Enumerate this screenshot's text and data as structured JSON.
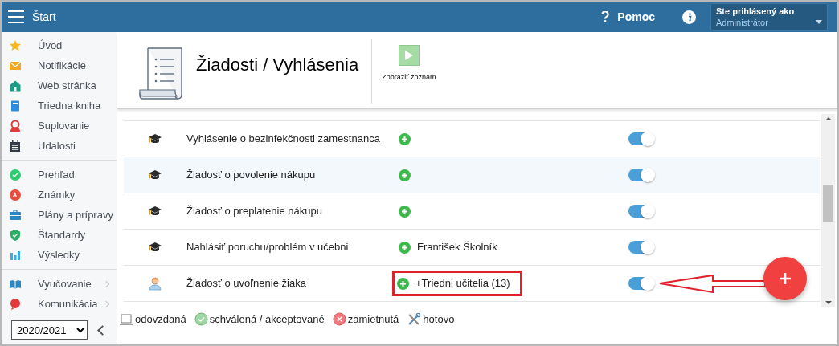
{
  "app_bar": {
    "title": "Štart",
    "help": "Pomoc",
    "user": {
      "label": "Ste prihlásený ako",
      "name": "Administrátor"
    }
  },
  "sidebar": {
    "groups": [
      {
        "items": [
          {
            "label": "Úvod",
            "submenu": false
          },
          {
            "label": "Notifikácie",
            "submenu": false
          },
          {
            "label": "Web stránka",
            "submenu": false
          },
          {
            "label": "Triedna kniha",
            "submenu": false
          },
          {
            "label": "Suplovanie",
            "submenu": false
          },
          {
            "label": "Udalosti",
            "submenu": false
          }
        ]
      },
      {
        "items": [
          {
            "label": "Prehľad",
            "submenu": false
          },
          {
            "label": "Známky",
            "submenu": false
          },
          {
            "label": "Plány a prípravy",
            "submenu": false
          },
          {
            "label": "Štandardy",
            "submenu": false
          },
          {
            "label": "Výsledky",
            "submenu": false
          }
        ]
      },
      {
        "items": [
          {
            "label": "Vyučovanie",
            "submenu": true
          },
          {
            "label": "Komunikácia",
            "submenu": true
          }
        ]
      }
    ],
    "year": "2020/2021"
  },
  "page": {
    "title": "Žiadosti / Vyhlásenia",
    "action": "Zobraziť zoznam"
  },
  "rows": [
    {
      "kind": "teacher",
      "name": "Vyhlásenie o bezinfekčnosti zamestnanca",
      "highlighted": false,
      "on": true
    },
    {
      "kind": "teacher",
      "name": "Žiadosť o povolenie nákupu",
      "highlighted": true,
      "on": true
    },
    {
      "kind": "teacher",
      "name": "Žiadosť o preplatenie nákupu",
      "highlighted": false,
      "on": true
    },
    {
      "kind": "teacher",
      "name": "Nahlásiť poruchu/problém v učebni",
      "recipient": "František Školník",
      "highlighted": false,
      "on": true
    },
    {
      "kind": "student",
      "name": "Žiadosť o uvoľnenie žiaka",
      "recipient": "+Triedni učitelia (13)",
      "annotated": true,
      "highlighted": false,
      "on": true
    }
  ],
  "legend": [
    {
      "kind": "sent",
      "label": "odovzdaná"
    },
    {
      "kind": "approved",
      "label": "schválená / akceptované"
    },
    {
      "kind": "rejected",
      "label": "zamietnutá"
    },
    {
      "kind": "done",
      "label": "hotovo"
    }
  ]
}
